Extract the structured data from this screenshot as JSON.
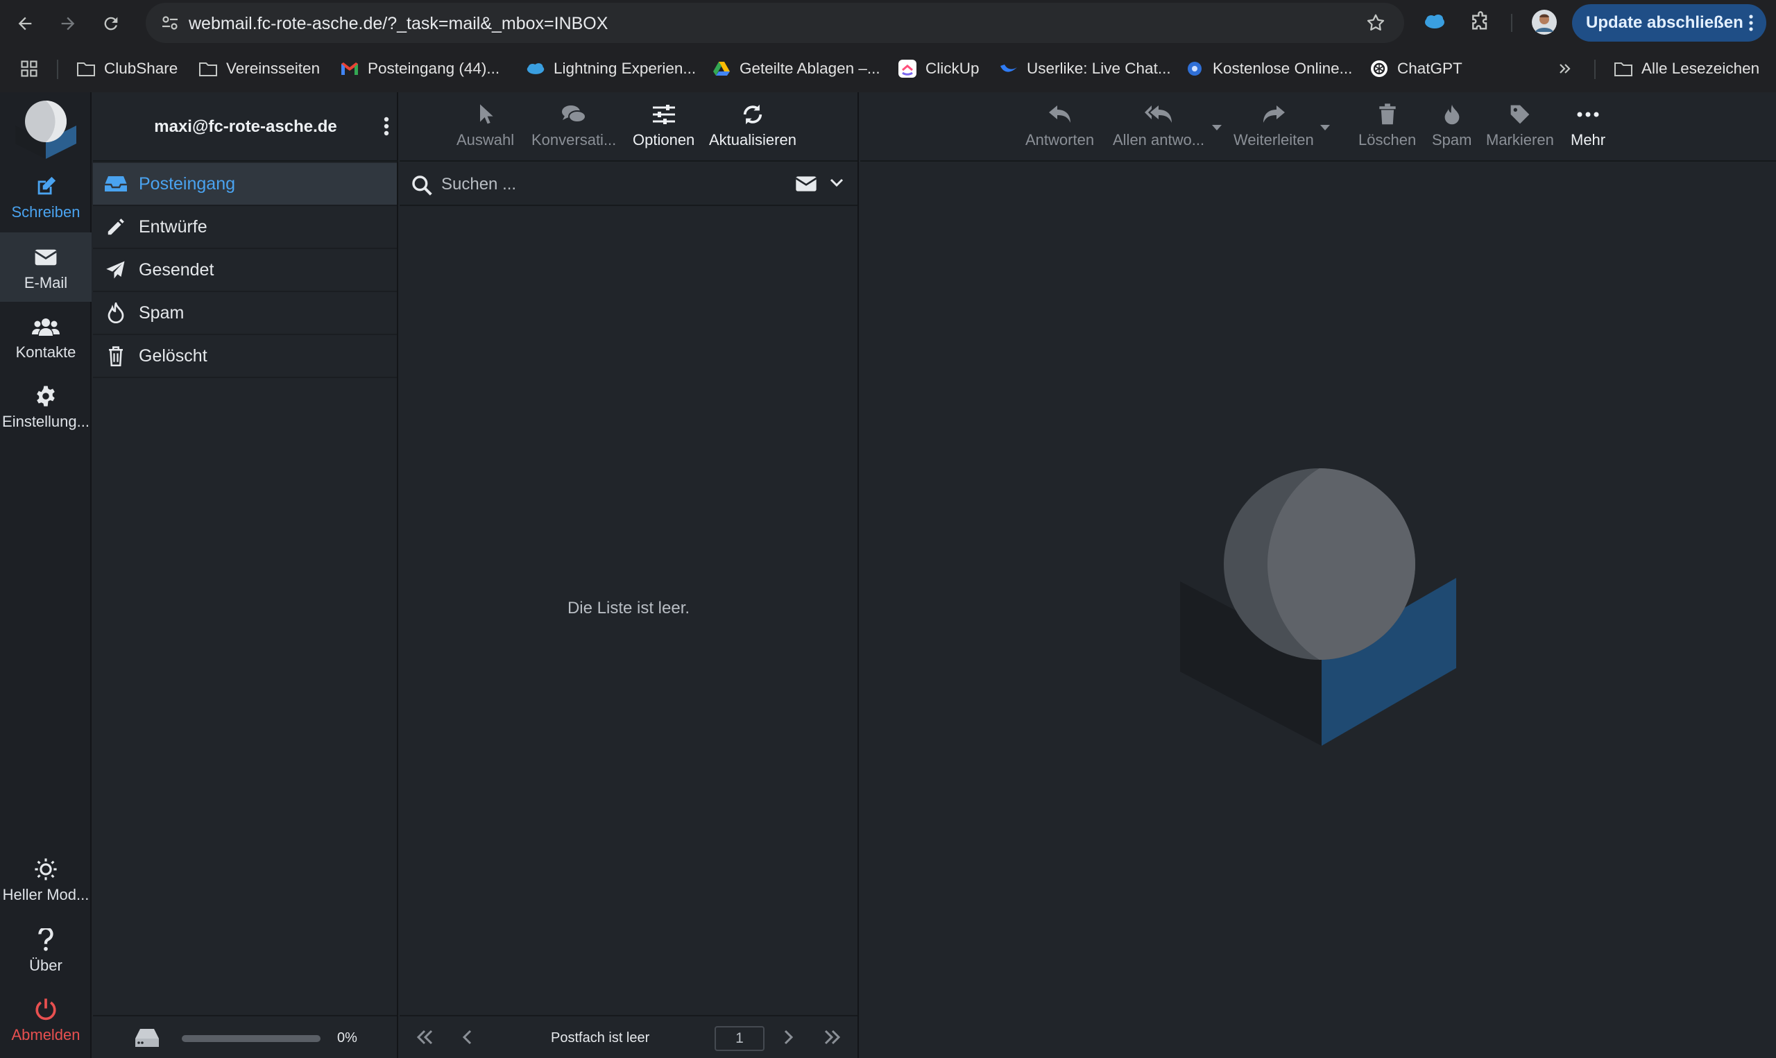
{
  "browser": {
    "url": "webmail.fc-rote-asche.de/?_task=mail&_mbox=INBOX",
    "update_label": "Update abschließen",
    "bookmarks": [
      {
        "label": "ClubShare",
        "icon": "folder-icon"
      },
      {
        "label": "Vereinsseiten",
        "icon": "folder-icon"
      },
      {
        "label": "Posteingang (44)...",
        "icon": "gmail-icon"
      },
      {
        "label": "Lightning Experien...",
        "icon": "salesforce-icon"
      },
      {
        "label": "Geteilte Ablagen –...",
        "icon": "google-drive-icon"
      },
      {
        "label": "ClickUp",
        "icon": "clickup-icon"
      },
      {
        "label": "Userlike: Live Chat...",
        "icon": "userlike-icon"
      },
      {
        "label": "Kostenlose Online...",
        "icon": "circle-icon"
      },
      {
        "label": "ChatGPT",
        "icon": "chatgpt-icon"
      }
    ],
    "all_bookmarks_label": "Alle Lesezeichen"
  },
  "rail": {
    "compose": "Schreiben",
    "mail": "E-Mail",
    "contacts": "Kontakte",
    "settings": "Einstellung...",
    "light_mode": "Heller Mod...",
    "about": "Über",
    "logout": "Abmelden"
  },
  "account": {
    "email": "maxi@fc-rote-asche.de"
  },
  "folders": [
    {
      "label": "Posteingang",
      "icon": "inbox-icon",
      "active": true
    },
    {
      "label": "Entwürfe",
      "icon": "pencil-icon",
      "active": false
    },
    {
      "label": "Gesendet",
      "icon": "paper-plane-icon",
      "active": false
    },
    {
      "label": "Spam",
      "icon": "fire-icon",
      "active": false
    },
    {
      "label": "Gelöscht",
      "icon": "trash-icon",
      "active": false
    }
  ],
  "quota": {
    "percent_label": "0%",
    "fraction": 0.0
  },
  "list_toolbar": {
    "select": "Auswahl",
    "threads": "Konversati...",
    "options": "Optionen",
    "refresh": "Aktualisieren"
  },
  "search": {
    "placeholder": "Suchen ...",
    "value": ""
  },
  "list": {
    "empty": "Die Liste ist leer."
  },
  "pager": {
    "status": "Postfach ist leer",
    "page": "1"
  },
  "content_toolbar": {
    "reply": "Antworten",
    "reply_all": "Allen antwo...",
    "forward": "Weiterleiten",
    "delete": "Löschen",
    "spam": "Spam",
    "mark": "Markieren",
    "more": "Mehr"
  },
  "colors": {
    "accent": "#4aa3f0",
    "logout": "#e85050",
    "update_button": "#1f4e86",
    "background": "#21252a"
  }
}
